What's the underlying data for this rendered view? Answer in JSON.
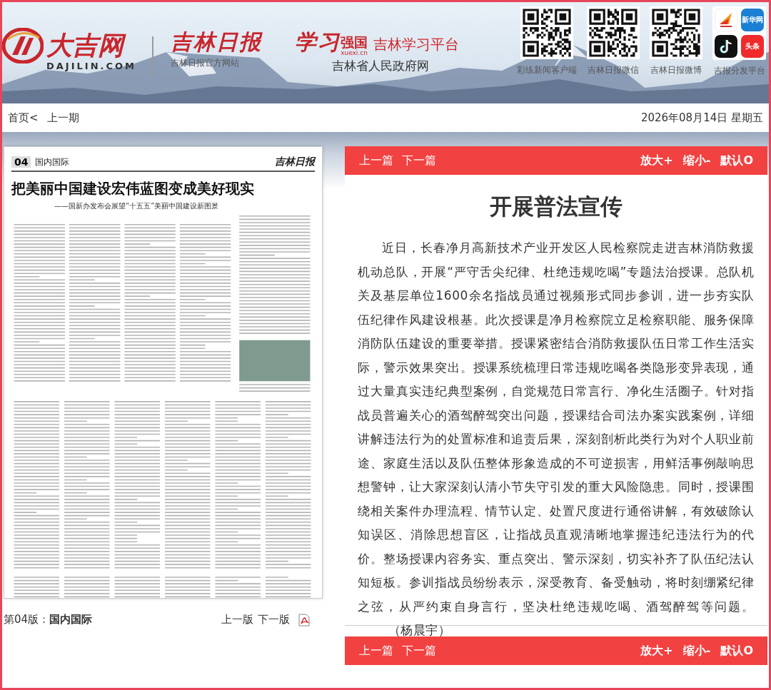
{
  "header": {
    "dajilin": {
      "name": "大吉网",
      "domain": "DAJILIN.COM"
    },
    "jlrb": {
      "name": "吉林日报",
      "caption": "吉林日报官方网站"
    },
    "xuexi": {
      "name": "学习",
      "name_bold": "强国",
      "domain": "xuexi.cn",
      "platform": "吉林学习平台",
      "caption": "吉林省人民政府网"
    },
    "qr_codes": [
      {
        "caption": "彩练新闻客户端"
      },
      {
        "caption": "吉林日报微信"
      },
      {
        "caption": "吉林日报微博"
      }
    ],
    "apps": {
      "tiles": [
        {
          "kind": "rmh"
        },
        {
          "kind": "xinhua",
          "label": "新华网"
        },
        {
          "kind": "douyin"
        },
        {
          "kind": "toutiao",
          "label": "头条"
        }
      ],
      "caption": "吉报分发平台"
    }
  },
  "nav": {
    "links": [
      "首页<",
      "上一期"
    ],
    "date": "2026年08月14日 星期五"
  },
  "newspaper": {
    "edition": "04",
    "section": "国内国际",
    "masthead": "吉林日报",
    "headline": "把美丽中国建设宏伟蓝图变成美好现实",
    "subtitle": "——国新办发布会展望“十五五”美丽中国建设新图景"
  },
  "page_footer": {
    "edition_label": "第04版：",
    "edition_name": "国内国际",
    "links": [
      "上一版",
      "下一版"
    ]
  },
  "article": {
    "top_bar": {
      "links": [
        "上一篇",
        "下一篇"
      ],
      "zoom": [
        "放大+",
        "缩小-",
        "默认O"
      ]
    },
    "title": "开展普法宣传",
    "body": "近日，长春净月高新技术产业开发区人民检察院走进吉林消防救援机动总队，开展“严守舌尖纪律、杜绝违规吃喝”专题法治授课。总队机关及基层单位1600余名指战员通过视频形式同步参训，进一步夯实队伍纪律作风建设根基。此次授课是净月检察院立足检察职能、服务保障消防队伍建设的重要举措。授课紧密结合消防救援队伍日常工作生活实际，警示效果突出。授课系统梳理日常违规吃喝各类隐形变异表现，通过大量真实违纪典型案例，自觉规范日常言行、净化生活圈子。针对指战员普遍关心的酒驾醉驾突出问题，授课结合司法办案实践案例，详细讲解违法行为的处置标准和追责后果，深刻剖析此类行为对个人职业前途、家庭生活以及队伍整体形象造成的不可逆损害，用鲜活事例敲响思想警钟，让大家深刻认清小节失守引发的重大风险隐患。同时，授课围绕相关案件办理流程、情节认定、处置尺度进行通俗讲解，有效破除认知误区、消除思想盲区，让指战员直观清晰地掌握违纪违法行为的代价。整场授课内容务实、重点突出、警示深刻，切实补齐了队伍纪法认知短板。参训指战员纷纷表示，深受教育、备受触动，将时刻绷紧纪律之弦，从严约束自身言行，坚决杜绝违规吃喝、酒驾醉驾等问题。",
    "author": "（杨晨宇）",
    "bottom_bar": {
      "links": [
        "上一篇",
        "下一篇"
      ],
      "zoom": [
        "放大+",
        "缩小-",
        "默认O"
      ]
    }
  }
}
